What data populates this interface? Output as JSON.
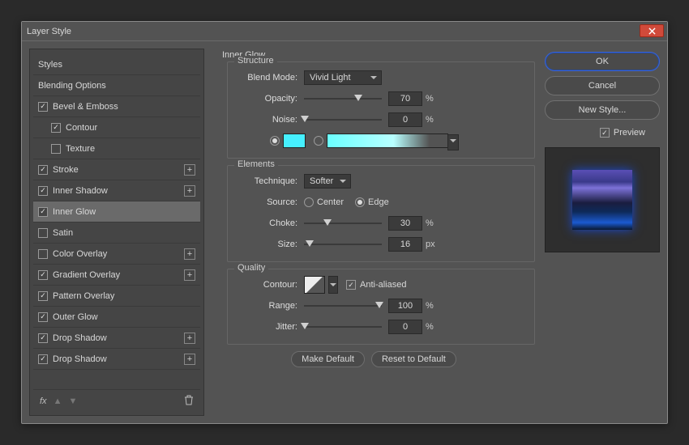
{
  "window": {
    "title": "Layer Style"
  },
  "left": {
    "items": [
      {
        "label": "Styles",
        "checkbox": false,
        "checked": false,
        "indent": false,
        "plus": false
      },
      {
        "label": "Blending Options",
        "checkbox": false,
        "checked": false,
        "indent": false,
        "plus": false
      },
      {
        "label": "Bevel & Emboss",
        "checkbox": true,
        "checked": true,
        "indent": false,
        "plus": false
      },
      {
        "label": "Contour",
        "checkbox": true,
        "checked": true,
        "indent": true,
        "plus": false
      },
      {
        "label": "Texture",
        "checkbox": true,
        "checked": false,
        "indent": true,
        "plus": false
      },
      {
        "label": "Stroke",
        "checkbox": true,
        "checked": true,
        "indent": false,
        "plus": true
      },
      {
        "label": "Inner Shadow",
        "checkbox": true,
        "checked": true,
        "indent": false,
        "plus": true
      },
      {
        "label": "Inner Glow",
        "checkbox": true,
        "checked": true,
        "indent": false,
        "plus": false,
        "selected": true
      },
      {
        "label": "Satin",
        "checkbox": true,
        "checked": false,
        "indent": false,
        "plus": false
      },
      {
        "label": "Color Overlay",
        "checkbox": true,
        "checked": false,
        "indent": false,
        "plus": true
      },
      {
        "label": "Gradient Overlay",
        "checkbox": true,
        "checked": true,
        "indent": false,
        "plus": true
      },
      {
        "label": "Pattern Overlay",
        "checkbox": true,
        "checked": true,
        "indent": false,
        "plus": false
      },
      {
        "label": "Outer Glow",
        "checkbox": true,
        "checked": true,
        "indent": false,
        "plus": false
      },
      {
        "label": "Drop Shadow",
        "checkbox": true,
        "checked": true,
        "indent": false,
        "plus": true
      },
      {
        "label": "Drop Shadow",
        "checkbox": true,
        "checked": true,
        "indent": false,
        "plus": true
      }
    ],
    "fx": "fx"
  },
  "panel_title": "Inner Glow",
  "structure": {
    "legend": "Structure",
    "blend_mode_label": "Blend Mode:",
    "blend_mode": "Vivid Light",
    "opacity_label": "Opacity:",
    "opacity": "70",
    "opacity_unit": "%",
    "noise_label": "Noise:",
    "noise": "0",
    "noise_unit": "%",
    "color": "#46f0ff",
    "gradient_start": "#6bffff"
  },
  "elements": {
    "legend": "Elements",
    "technique_label": "Technique:",
    "technique": "Softer",
    "source_label": "Source:",
    "source_center": "Center",
    "source_edge": "Edge",
    "choke_label": "Choke:",
    "choke": "30",
    "choke_unit": "%",
    "size_label": "Size:",
    "size": "16",
    "size_unit": "px"
  },
  "quality": {
    "legend": "Quality",
    "contour_label": "Contour:",
    "aa": "Anti-aliased",
    "range_label": "Range:",
    "range": "100",
    "range_unit": "%",
    "jitter_label": "Jitter:",
    "jitter": "0",
    "jitter_unit": "%"
  },
  "buttons": {
    "make_default": "Make Default",
    "reset": "Reset to Default"
  },
  "right": {
    "ok": "OK",
    "cancel": "Cancel",
    "new_style": "New Style...",
    "preview": "Preview"
  }
}
